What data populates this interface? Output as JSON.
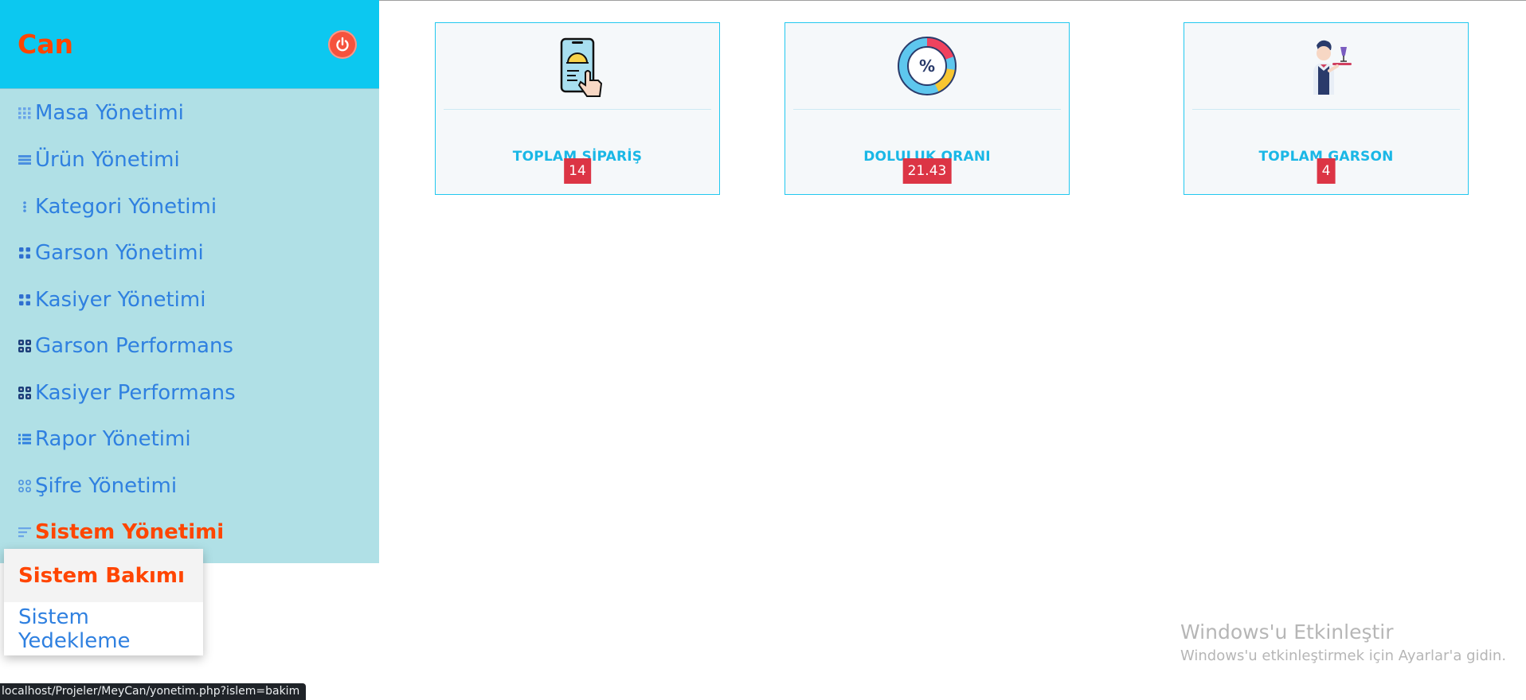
{
  "brand": "Can",
  "sidebar": {
    "items": [
      {
        "label": "Masa Yönetimi",
        "icon": "grid-icon"
      },
      {
        "label": "Ürün Yönetimi",
        "icon": "list-icon"
      },
      {
        "label": "Kategori Yönetimi",
        "icon": "ellipsis-vertical-icon"
      },
      {
        "label": "Garson Yönetimi",
        "icon": "four-dots-icon"
      },
      {
        "label": "Kasiyer Yönetimi",
        "icon": "four-dots-icon"
      },
      {
        "label": "Garson Performans",
        "icon": "four-squares-icon"
      },
      {
        "label": "Kasiyer Performans",
        "icon": "four-squares-icon"
      },
      {
        "label": "Rapor Yönetimi",
        "icon": "bullet-list-icon"
      },
      {
        "label": "Şifre Yönetimi",
        "icon": "command-icon"
      },
      {
        "label": "Sistem Yönetimi",
        "icon": "align-left-icon"
      }
    ],
    "submenu": [
      {
        "label": "Sistem Bakımı"
      },
      {
        "label": "Sistem Yedekleme"
      }
    ]
  },
  "cards": [
    {
      "title": "TOPLAM SİPARİŞ",
      "value": "14",
      "icon": "phone-order-icon"
    },
    {
      "title": "DOLULUK ORANI",
      "value": "21.43",
      "icon": "percentage-donut-icon"
    },
    {
      "title": "TOPLAM GARSON",
      "value": "4",
      "icon": "waiter-icon"
    }
  ],
  "watermark": {
    "line1": "Windows'u Etkinleştir",
    "line2": "Windows'u etkinleştirmek için Ayarlar'a gidin."
  },
  "status_url": "localhost/Projeler/MeyCan/yonetim.php?islem=bakim",
  "colors": {
    "header": "#0cc8f0",
    "sidebar": "#b0e0e6",
    "active": "#ff4500",
    "link": "#2f80e0",
    "badge": "#dc3545",
    "card_title": "#1ab7e6"
  }
}
